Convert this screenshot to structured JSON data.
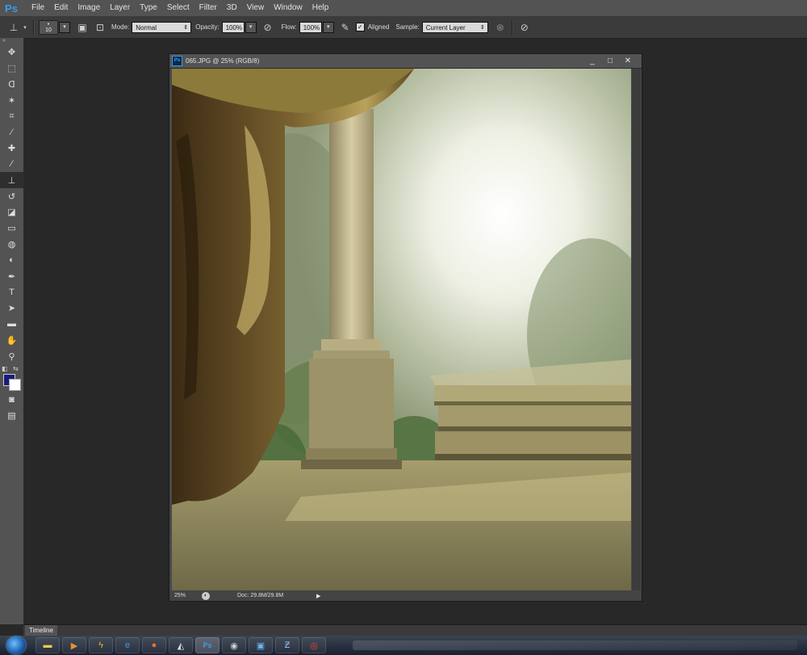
{
  "app": {
    "logo": "Ps"
  },
  "menu": [
    "File",
    "Edit",
    "Image",
    "Layer",
    "Type",
    "Select",
    "Filter",
    "3D",
    "View",
    "Window",
    "Help"
  ],
  "options": {
    "tool_icon": "clone-stamp-icon",
    "brush_size": "10",
    "mode_label": "Mode:",
    "mode_value": "Normal",
    "opacity_label": "Opacity:",
    "opacity_value": "100%",
    "flow_label": "Flow:",
    "flow_value": "100%",
    "aligned_label": "Aligned",
    "aligned_checked": true,
    "sample_label": "Sample:",
    "sample_value": "Current Layer"
  },
  "tools": [
    "move-tool-icon",
    "marquee-tool-icon",
    "lasso-tool-icon",
    "magic-wand-icon",
    "crop-tool-icon",
    "eyedropper-icon",
    "healing-brush-icon",
    "brush-tool-icon",
    "clone-stamp-icon",
    "history-brush-icon",
    "eraser-icon",
    "gradient-tool-icon",
    "blur-tool-icon",
    "dodge-tool-icon",
    "pen-tool-icon",
    "type-tool-icon",
    "path-selection-icon",
    "rectangle-tool-icon",
    "hand-tool-icon",
    "zoom-tool-icon"
  ],
  "colors": {
    "foreground": "#1a1a7a",
    "background": "#ffffff"
  },
  "document": {
    "title": "065.JPG @ 25% (RGB/8)",
    "zoom": "25%",
    "doc_info": "Doc: 29.8M/29.8M",
    "min_symbol": "_",
    "max_symbol": "□",
    "close_symbol": "✕"
  },
  "timeline": {
    "label": "Timeline"
  },
  "taskbar": {
    "items": [
      "explorer-icon",
      "media-player-icon",
      "winamp-icon",
      "internet-explorer-icon",
      "firefox-icon",
      "inkscape-icon",
      "photoshop-icon",
      "app-icon",
      "monitor-icon",
      "app2-icon",
      "chrome-icon"
    ]
  }
}
